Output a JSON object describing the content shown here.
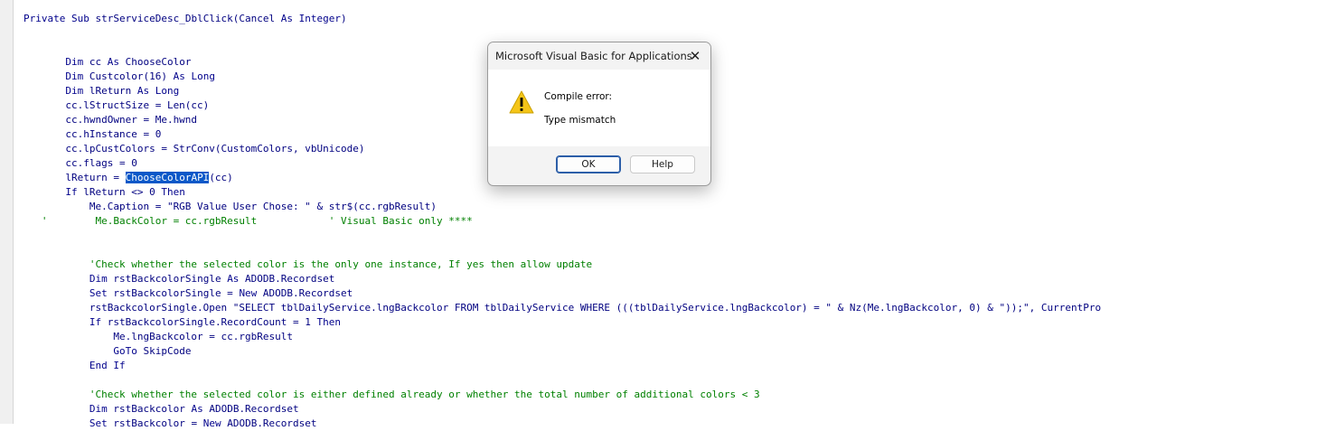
{
  "code": {
    "lines": [
      [
        {
          "t": "Private Sub ",
          "c": "kw"
        },
        {
          "t": "strServiceDesc_DblClick(Cancel "
        },
        {
          "t": "As Integer",
          "c": "kw"
        },
        {
          "t": ")"
        }
      ],
      [],
      [],
      [
        {
          "t": "       "
        },
        {
          "t": "Dim",
          "c": "kw"
        },
        {
          "t": " cc "
        },
        {
          "t": "As",
          "c": "kw"
        },
        {
          "t": " ChooseColor"
        }
      ],
      [
        {
          "t": "       "
        },
        {
          "t": "Dim",
          "c": "kw"
        },
        {
          "t": " Custcolor(16) "
        },
        {
          "t": "As Long",
          "c": "kw"
        }
      ],
      [
        {
          "t": "       "
        },
        {
          "t": "Dim",
          "c": "kw"
        },
        {
          "t": " lReturn "
        },
        {
          "t": "As Long",
          "c": "kw"
        }
      ],
      [
        {
          "t": "       cc.lStructSize = Len(cc)"
        }
      ],
      [
        {
          "t": "       cc.hwndOwner = Me.hwnd"
        }
      ],
      [
        {
          "t": "       cc.hInstance = 0"
        }
      ],
      [
        {
          "t": "       cc.lpCustColors = StrConv(CustomColors, vbUnicode)"
        }
      ],
      [
        {
          "t": "       cc.flags = 0"
        }
      ],
      [
        {
          "t": "       lReturn = "
        },
        {
          "t": "ChooseColorAPI",
          "c": "sel"
        },
        {
          "t": "(cc)"
        }
      ],
      [
        {
          "t": "       "
        },
        {
          "t": "If",
          "c": "kw"
        },
        {
          "t": " lReturn <> 0 "
        },
        {
          "t": "Then",
          "c": "kw"
        }
      ],
      [
        {
          "t": "           Me.Caption = \"RGB Value User Chose: \" & str$(cc.rgbResult)"
        }
      ],
      [
        {
          "t": "   '        Me.BackColor = cc.rgbResult            ' Visual Basic only ****",
          "c": "cm"
        }
      ],
      [],
      [],
      [
        {
          "t": "           'Check whether the selected color is the only one instance, If yes then allow update",
          "c": "cm"
        }
      ],
      [
        {
          "t": "           "
        },
        {
          "t": "Dim",
          "c": "kw"
        },
        {
          "t": " rstBackcolorSingle "
        },
        {
          "t": "As",
          "c": "kw"
        },
        {
          "t": " ADODB.Recordset"
        }
      ],
      [
        {
          "t": "           "
        },
        {
          "t": "Set",
          "c": "kw"
        },
        {
          "t": " rstBackcolorSingle = "
        },
        {
          "t": "New",
          "c": "kw"
        },
        {
          "t": " ADODB.Recordset"
        }
      ],
      [
        {
          "t": "           rstBackcolorSingle.Open \"SELECT tblDailyService.lngBackcolor FROM tblDailyService WHERE (((tblDailyService.lngBackcolor) = \" & Nz(Me.lngBackcolor, 0) & \"));\", CurrentPro"
        }
      ],
      [
        {
          "t": "           "
        },
        {
          "t": "If",
          "c": "kw"
        },
        {
          "t": " rstBackcolorSingle.RecordCount = 1 "
        },
        {
          "t": "Then",
          "c": "kw"
        }
      ],
      [
        {
          "t": "               Me.lngBackcolor = cc.rgbResult"
        }
      ],
      [
        {
          "t": "               "
        },
        {
          "t": "GoTo",
          "c": "kw"
        },
        {
          "t": " SkipCode"
        }
      ],
      [
        {
          "t": "           "
        },
        {
          "t": "End If",
          "c": "kw"
        }
      ],
      [],
      [
        {
          "t": "           'Check whether the selected color is either defined already or whether the total number of additional colors < 3",
          "c": "cm"
        }
      ],
      [
        {
          "t": "           "
        },
        {
          "t": "Dim",
          "c": "kw"
        },
        {
          "t": " rstBackcolor "
        },
        {
          "t": "As",
          "c": "kw"
        },
        {
          "t": " ADODB.Recordset"
        }
      ],
      [
        {
          "t": "           "
        },
        {
          "t": "Set",
          "c": "kw"
        },
        {
          "t": " rstBackcolor = "
        },
        {
          "t": "New",
          "c": "kw"
        },
        {
          "t": " ADODB.Recordset"
        }
      ]
    ]
  },
  "dialog": {
    "title": "Microsoft Visual Basic for Applications",
    "close_glyph": "✕",
    "icon": "warning-icon",
    "message_line1": "Compile error:",
    "message_line2": "Type mismatch",
    "ok_label": "OK",
    "help_label": "Help"
  },
  "colors": {
    "keyword": "#00008b",
    "comment": "#008000",
    "selection": "#0a58c8"
  }
}
